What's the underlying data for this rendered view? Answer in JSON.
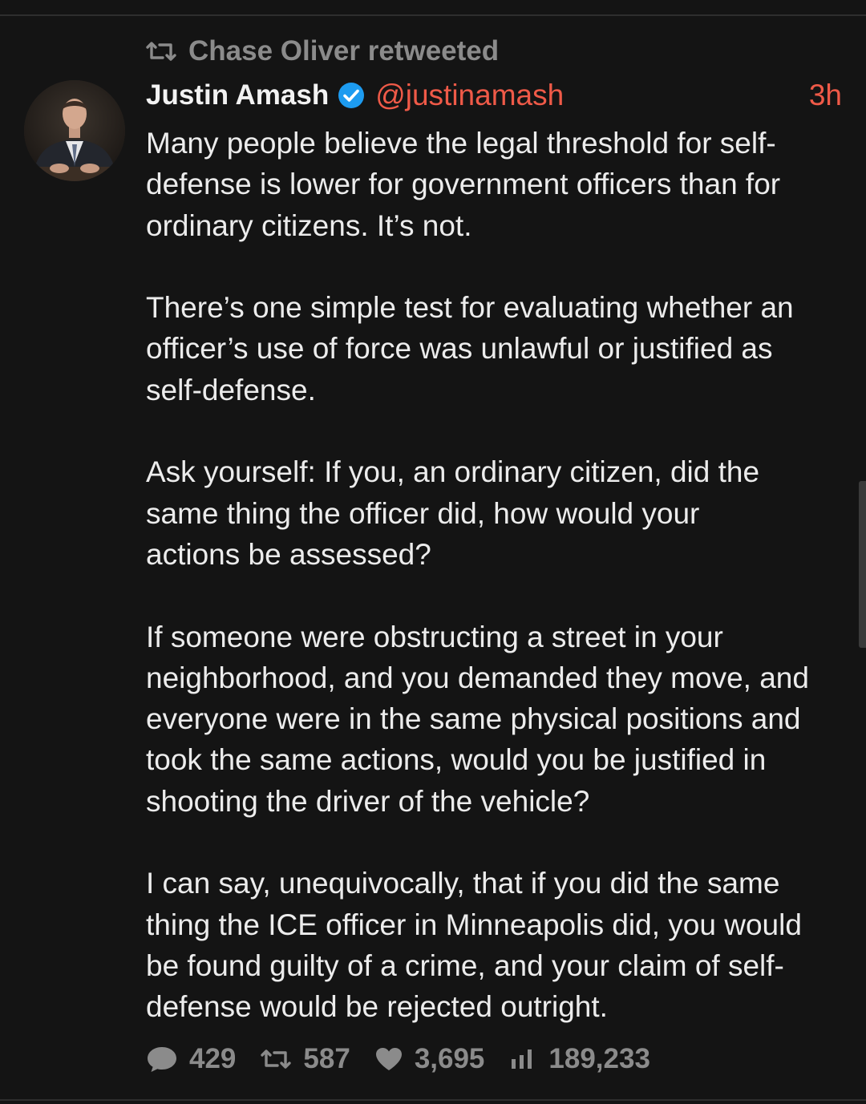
{
  "retweet": {
    "icon": "retweet-icon",
    "text": "Chase Oliver retweeted"
  },
  "author": {
    "name": "Justin Amash",
    "verified_icon": "verified-badge-icon",
    "handle": "@justinamash",
    "timestamp": "3h",
    "accent_color": "#ef5a48",
    "verified_color": "#1d9bf0"
  },
  "tweet": {
    "paragraphs": [
      "Many people believe the legal threshold for self-\ndefense is lower for government officers than for\nordinary citizens. It’s not.",
      "There’s one simple test for evaluating whether an\nofficer’s use of force was unlawful or justified as\nself-defense.",
      "Ask yourself: If you, an ordinary citizen, did the\nsame thing the officer did, how would your\nactions be assessed?",
      "If someone were obstructing a street in your\nneighborhood, and you demanded they move, and\neveryone were in the same physical positions and\ntook the same actions, would you be justified in\nshooting the driver of the vehicle?",
      "I can say, unequivocally, that if you did the same\nthing the ICE officer in Minneapolis did, you would\nbe found guilty of a crime, and your claim of self-\ndefense would be rejected outright."
    ]
  },
  "stats": {
    "replies": {
      "icon": "reply-bubble-icon",
      "count": "429"
    },
    "retweets": {
      "icon": "retweet-icon",
      "count": "587"
    },
    "likes": {
      "icon": "heart-icon",
      "count": "3,695"
    },
    "views": {
      "icon": "bar-chart-icon",
      "count": "189,233"
    }
  }
}
